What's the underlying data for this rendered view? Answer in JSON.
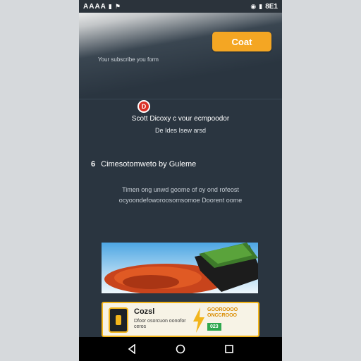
{
  "status_bar": {
    "left_text": "AAAA",
    "right_text": "8E1",
    "icons": [
      "notification-icon",
      "wifi-icon",
      "battery-icon"
    ]
  },
  "header": {
    "cta_label": "Coat",
    "subtitle": "Your subscribe you form"
  },
  "notice": {
    "line1": "Scott Dicoxy c vour ecmpoodor",
    "line2": "De Ides Isew arsd"
  },
  "section": {
    "number": "6",
    "title": "Cimesotomweto by Guleme"
  },
  "paragraph": "Timen ong unwd goome of oy ond rofeost ocyoondefoworoosomsomoe Doorent oome",
  "promo": {
    "title": "Cozsl",
    "text": "Dfoor osorcuon oonofor ceros",
    "panel_title": "GOOROOOO ONCCROOO",
    "offer": "023"
  },
  "colors": {
    "accent": "#f4a623",
    "background": "#2a3540",
    "badge": "#d93025",
    "promo_border": "#f2b51c"
  }
}
